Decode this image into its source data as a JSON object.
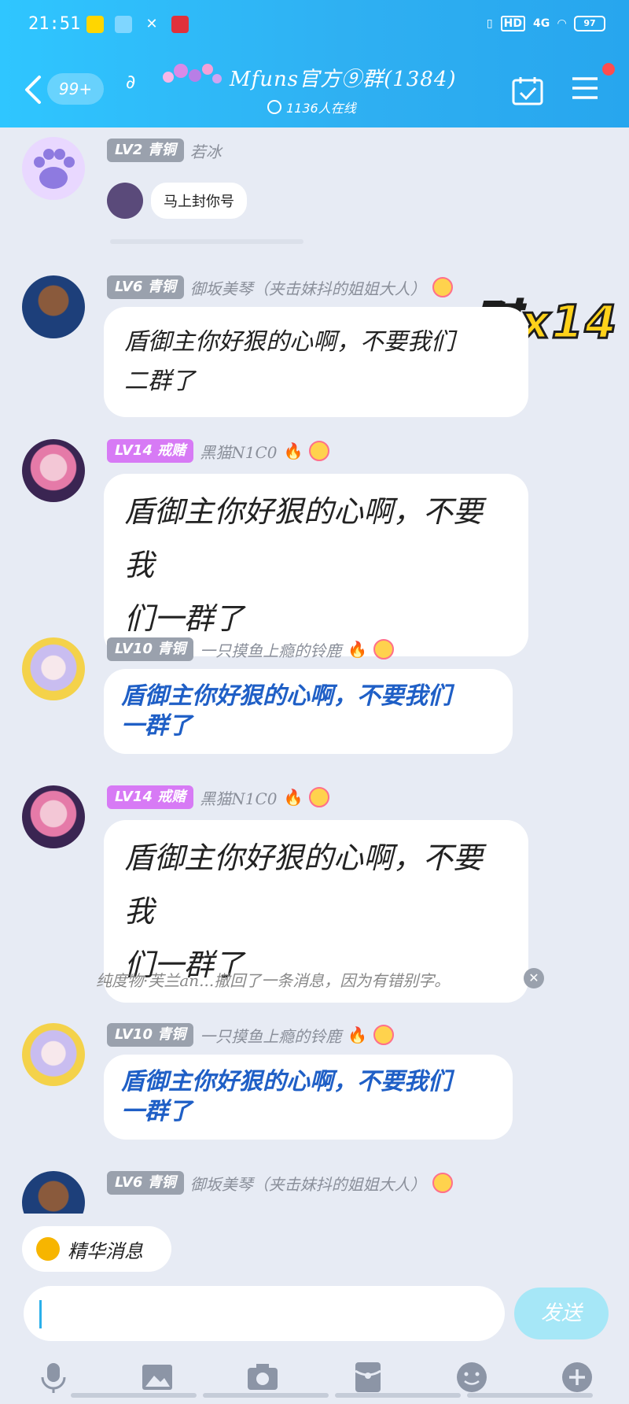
{
  "status_bar": {
    "time": "21:51",
    "network": "4G",
    "hd": "HD",
    "battery": "97"
  },
  "header": {
    "back_badge": "99+",
    "title": "Mfuns官方⑨群(1384)",
    "online": "1136人在线",
    "colors": {
      "accent": "#2fb8f5",
      "notify_dot": "#ff4d4f"
    }
  },
  "combo_badge": "怼x14",
  "messages": [
    {
      "level": "LV2 青铜",
      "name": "若冰",
      "sticker_text": "马上封你号"
    },
    {
      "level": "LV6 青铜",
      "name": "御坂美琴（夹击妹抖的姐姐大人）",
      "lines": [
        "盾御主你好狠的心啊，不要我们",
        "二群了"
      ]
    },
    {
      "level": "LV14 戒赌",
      "name": "黑猫N1C0",
      "lines": [
        "盾御主你好狠的心啊，不要我",
        "们一群了"
      ]
    },
    {
      "level": "LV10 青铜",
      "name": "一只摸鱼上瘾的铃鹿",
      "lines": [
        "盾御主你好狠的心啊，不要我们",
        "一群了"
      ]
    },
    {
      "level": "LV14 戒赌",
      "name": "黑猫N1C0",
      "lines": [
        "盾御主你好狠的心啊，不要我",
        "们一群了"
      ]
    },
    {
      "level": "LV10 青铜",
      "name": "一只摸鱼上瘾的铃鹿",
      "lines": [
        "盾御主你好狠的心啊，不要我们",
        "一群了"
      ]
    },
    {
      "level": "LV6 青铜",
      "name": "御坂美琴（夹击妹抖的姐姐大人）"
    }
  ],
  "system_notice": "纯度物·芙兰an...撤回了一条消息，因为有错别字。",
  "essence_label": "精华消息",
  "input": {
    "value": "",
    "send_label": "发送"
  },
  "toolbar_icons": [
    "mic-icon",
    "image-icon",
    "camera-icon",
    "red-packet-icon",
    "emoji-icon",
    "plus-icon"
  ]
}
